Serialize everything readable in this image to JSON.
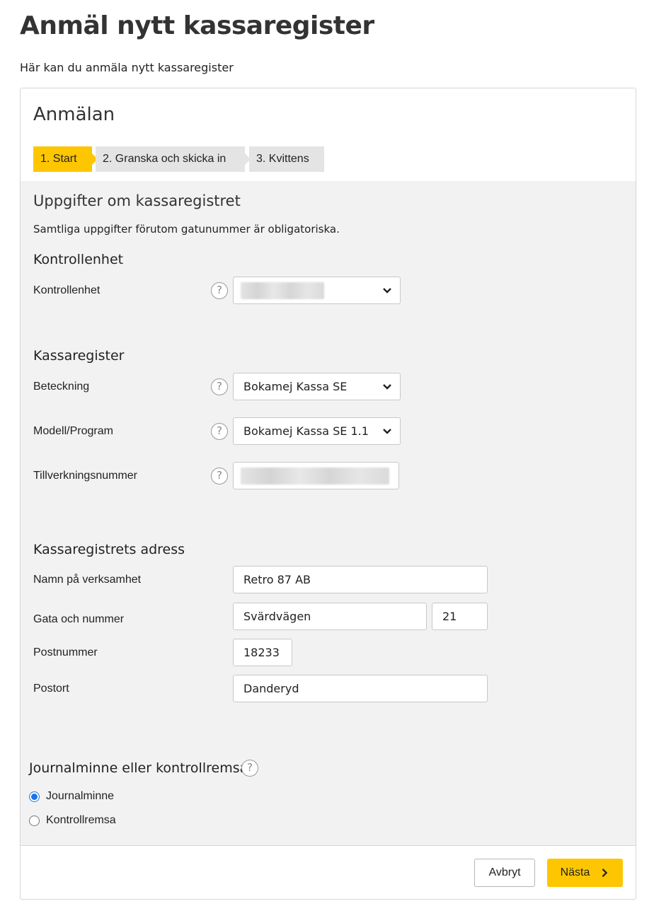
{
  "page": {
    "title": "Anmäl nytt kassaregister",
    "intro": "Här kan du anmäla nytt kassaregister"
  },
  "card": {
    "title": "Anmälan",
    "steps": [
      {
        "label": "1. Start",
        "active": true
      },
      {
        "label": "2. Granska och skicka in",
        "active": false
      },
      {
        "label": "3. Kvittens",
        "active": false
      }
    ]
  },
  "form": {
    "section_title": "Uppgifter om kassaregistret",
    "required_note": "Samtliga uppgifter förutom gatunummer är obligatoriska.",
    "kontrollenhet": {
      "heading": "Kontrollenhet",
      "label": "Kontrollenhet",
      "value": ""
    },
    "kassaregister": {
      "heading": "Kassaregister",
      "beteckning": {
        "label": "Beteckning",
        "value": "Bokamej Kassa SE"
      },
      "modell": {
        "label": "Modell/Program",
        "value": "Bokamej Kassa SE 1.1"
      },
      "tillverkningsnummer": {
        "label": "Tillverkningsnummer",
        "value": ""
      }
    },
    "adress": {
      "heading": "Kassaregistrets adress",
      "namn": {
        "label": "Namn på verksamhet",
        "value": "Retro 87 AB"
      },
      "gata": {
        "label": "Gata och nummer",
        "street": "Svärdvägen",
        "number": "21"
      },
      "postnummer": {
        "label": "Postnummer",
        "value": "18233"
      },
      "postort": {
        "label": "Postort",
        "value": "Danderyd"
      }
    },
    "journal": {
      "heading": "Journalminne eller kontrollremsa",
      "options": [
        {
          "label": "Journalminne",
          "selected": true
        },
        {
          "label": "Kontrollremsa",
          "selected": false
        }
      ]
    }
  },
  "icons": {
    "help": "?"
  },
  "actions": {
    "cancel": "Avbryt",
    "next": "Nästa"
  },
  "colors": {
    "accent": "#fec600",
    "step_inactive": "#e4e4e4",
    "form_bg": "#f2f2f2",
    "radio_selected": "#1a73e8"
  }
}
